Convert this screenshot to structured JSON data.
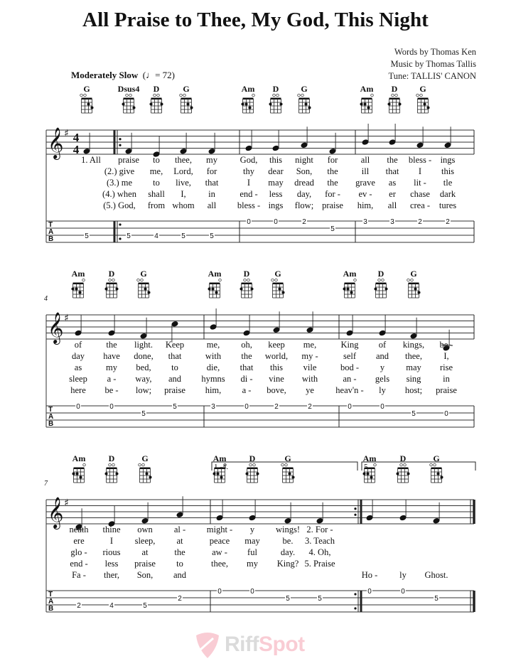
{
  "title": "All Praise to Thee, My God, This Night",
  "credits": {
    "words": "Words by Thomas Ken",
    "music": "Music by Thomas Tallis",
    "tune": "Tune: TALLIS' CANON"
  },
  "tempo": {
    "label": "Moderately Slow",
    "bpm_text": "= 72"
  },
  "time_signature": "4/4",
  "key_signature": "G major (1 sharp)",
  "instrument_tab_strings": 4,
  "systems": [
    {
      "measure_number": "",
      "chords": [
        "G",
        "Dsus4",
        "D",
        "G",
        "Am",
        "D",
        "G",
        "Am",
        "D",
        "G"
      ],
      "measures": [
        {
          "notes": [
            "G"
          ],
          "tab": [
            {
              "string": 3,
              "fret": "5"
            }
          ],
          "pickup": true
        },
        {
          "notes": [
            "G",
            "F#",
            "G",
            "G"
          ],
          "repeat_start": true,
          "tab": [
            {
              "string": 3,
              "fret": "5"
            },
            {
              "string": 3,
              "fret": "4"
            },
            {
              "string": 3,
              "fret": "5"
            },
            {
              "string": 3,
              "fret": "5"
            }
          ]
        },
        {
          "notes": [
            "A",
            "A",
            "B",
            "G"
          ],
          "tab": [
            {
              "string": 1,
              "fret": "0"
            },
            {
              "string": 1,
              "fret": "0"
            },
            {
              "string": 1,
              "fret": "2"
            },
            {
              "string": 2,
              "fret": "5"
            }
          ]
        },
        {
          "notes": [
            "C",
            "C",
            "B",
            "B"
          ],
          "tab": [
            {
              "string": 1,
              "fret": "3"
            },
            {
              "string": 1,
              "fret": "3"
            },
            {
              "string": 1,
              "fret": "2"
            },
            {
              "string": 1,
              "fret": "2"
            }
          ]
        }
      ],
      "lyrics": [
        [
          "1. All",
          "praise",
          "to",
          "thee,",
          "my",
          "God,",
          "this",
          "night",
          "for",
          "all",
          "the",
          "bless -",
          "ings"
        ],
        [
          "(2.) give",
          "me,",
          "Lord,",
          "for",
          "thy",
          "dear",
          "Son,",
          "the",
          "ill",
          "that",
          "I",
          "this"
        ],
        [
          "(3.) me",
          "to",
          "live,",
          "that",
          "I",
          "may",
          "dread",
          "the",
          "grave",
          "as",
          "lit -",
          "tle"
        ],
        [
          "(4.) when",
          "shall",
          "I,",
          "in",
          "end -",
          "less",
          "day,",
          "for -",
          "ev -",
          "er",
          "chase",
          "dark"
        ],
        [
          "(5.) God,",
          "from",
          "whom",
          "all",
          "bless -",
          "ings",
          "flow;",
          "praise",
          "him,",
          "all",
          "crea -",
          "tures"
        ]
      ]
    },
    {
      "measure_number": "4",
      "chords": [
        "Am",
        "D",
        "G",
        "Am",
        "D",
        "G",
        "Am",
        "D",
        "G"
      ],
      "measures": [
        {
          "notes": [
            "A",
            "A",
            "G",
            "D"
          ],
          "tab": [
            {
              "string": 1,
              "fret": "0"
            },
            {
              "string": 1,
              "fret": "0"
            },
            {
              "string": 2,
              "fret": "5"
            },
            {
              "string": 1,
              "fret": "5"
            }
          ]
        },
        {
          "notes": [
            "C",
            "A",
            "B",
            "B"
          ],
          "tab": [
            {
              "string": 1,
              "fret": "3"
            },
            {
              "string": 1,
              "fret": "0"
            },
            {
              "string": 1,
              "fret": "2"
            },
            {
              "string": 1,
              "fret": "2"
            }
          ]
        },
        {
          "notes": [
            "A",
            "A",
            "G",
            "D"
          ],
          "tab": [
            {
              "string": 1,
              "fret": "0"
            },
            {
              "string": 1,
              "fret": "0"
            },
            {
              "string": 2,
              "fret": "5"
            },
            {
              "string": 2,
              "fret": "0"
            }
          ]
        }
      ],
      "lyrics": [
        [
          "of",
          "the",
          "light.",
          "Keep",
          "me,",
          "oh,",
          "keep",
          "me,",
          "King",
          "of",
          "kings,",
          "be -"
        ],
        [
          "day",
          "have",
          "done,",
          "that",
          "with",
          "the",
          "world,",
          "my -",
          "self",
          "and",
          "thee,",
          "I,"
        ],
        [
          "as",
          "my",
          "bed,",
          "to",
          "die,",
          "that",
          "this",
          "vile",
          "bod -",
          "y",
          "may",
          "rise"
        ],
        [
          "sleep",
          "a -",
          "way,",
          "and",
          "hymns",
          "di -",
          "vine",
          "with",
          "an -",
          "gels",
          "sing",
          "in"
        ],
        [
          "here",
          "be -",
          "low;",
          "praise",
          "him,",
          "a -",
          "bove,",
          "ye",
          "heav'n -",
          "ly",
          "host;",
          "praise"
        ]
      ]
    },
    {
      "measure_number": "7",
      "chords": [
        "Am",
        "D",
        "G",
        "Am",
        "D",
        "G",
        "Am",
        "D",
        "G"
      ],
      "endings": [
        "1.-4.",
        "5."
      ],
      "measures": [
        {
          "notes": [
            "E",
            "F#",
            "G",
            "B"
          ],
          "tab": [
            {
              "string": 3,
              "fret": "2"
            },
            {
              "string": 3,
              "fret": "4"
            },
            {
              "string": 3,
              "fret": "5"
            },
            {
              "string": 2,
              "fret": "2"
            }
          ]
        },
        {
          "notes": [
            "A",
            "A",
            "G",
            "G"
          ],
          "repeat_end": true,
          "tab": [
            {
              "string": 1,
              "fret": "0"
            },
            {
              "string": 1,
              "fret": "0"
            },
            {
              "string": 2,
              "fret": "5"
            },
            {
              "string": 2,
              "fret": "5"
            }
          ]
        },
        {
          "notes": [
            "A",
            "A",
            "G"
          ],
          "final": true,
          "tab": [
            {
              "string": 1,
              "fret": "0"
            },
            {
              "string": 1,
              "fret": "0"
            },
            {
              "string": 2,
              "fret": "5"
            }
          ]
        }
      ],
      "lyrics": [
        [
          "neath",
          "thine",
          "own",
          "al -",
          "might -",
          "y",
          "wings!",
          "2. For -"
        ],
        [
          "ere",
          "I",
          "sleep,",
          "at",
          "peace",
          "may",
          "be.",
          "3. Teach"
        ],
        [
          "glo -",
          "rious",
          "at",
          "the",
          "aw -",
          "ful",
          "day.",
          "4. Oh,"
        ],
        [
          "end -",
          "less",
          "praise",
          "to",
          "thee,",
          "my",
          "King?",
          "5. Praise"
        ],
        [
          "Fa -",
          "ther,",
          "Son,",
          "and",
          "Ho -",
          "ly",
          "Ghost."
        ]
      ]
    }
  ],
  "watermark": {
    "riff": "Riff",
    "spot": "Spot",
    "icon": "guitar-pick-icon",
    "colors": {
      "riff": "#9a9a9a",
      "spot": "#f06f86"
    }
  }
}
